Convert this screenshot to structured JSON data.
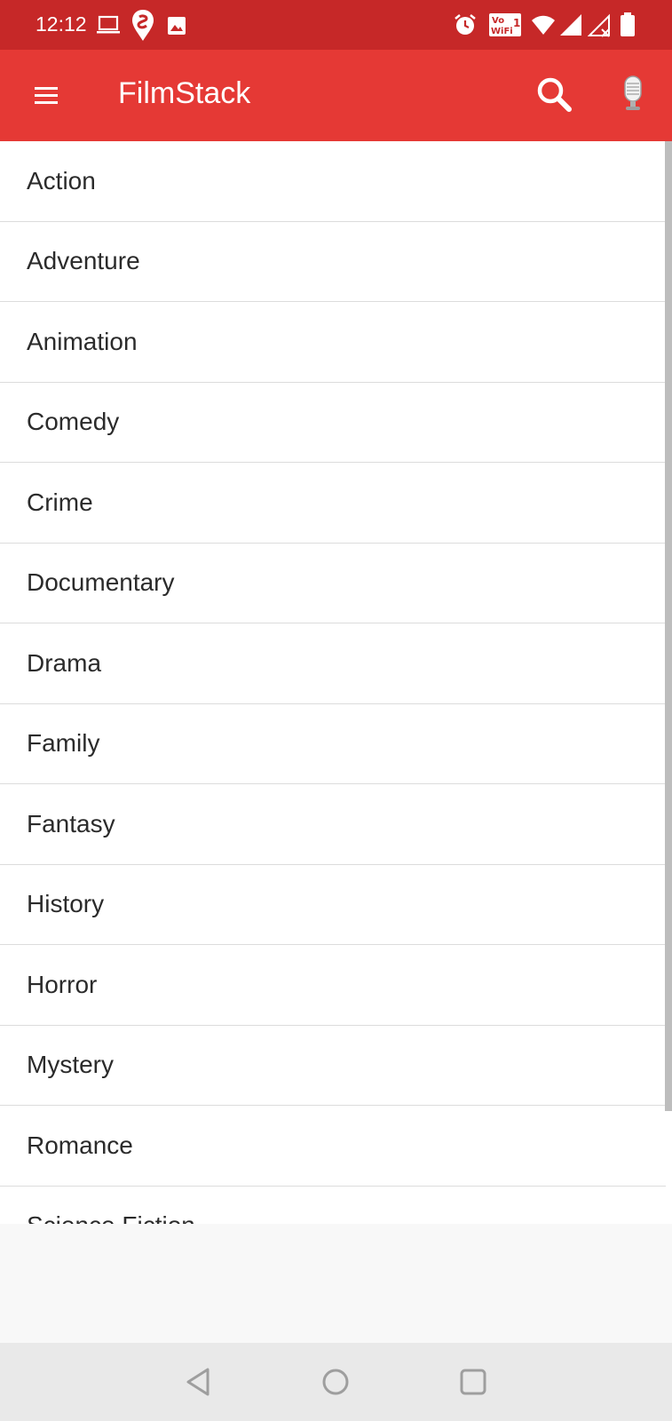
{
  "status_bar": {
    "time": "12:12",
    "left_icons": [
      "laptop-icon",
      "swiggy-icon",
      "image-icon"
    ],
    "right_icons": [
      "alarm-icon",
      "vowifi-icon",
      "wifi-icon",
      "signal-icon",
      "signal-no-data-icon",
      "battery-icon"
    ],
    "vowifi_text": "Vo WiFi",
    "bg_color": "#c62828"
  },
  "app_bar": {
    "title": "FilmStack",
    "menu_icon": "hamburger-menu-icon",
    "search_icon": "search-icon",
    "mic_icon": "microphone-icon",
    "bg_color": "#e53935"
  },
  "genres": [
    {
      "label": "Action"
    },
    {
      "label": "Adventure"
    },
    {
      "label": "Animation"
    },
    {
      "label": "Comedy"
    },
    {
      "label": "Crime"
    },
    {
      "label": "Documentary"
    },
    {
      "label": "Drama"
    },
    {
      "label": "Family"
    },
    {
      "label": "Fantasy"
    },
    {
      "label": "History"
    },
    {
      "label": "Horror"
    },
    {
      "label": "Mystery"
    },
    {
      "label": "Romance"
    },
    {
      "label": "Science Fiction"
    }
  ],
  "nav_bar": {
    "back_icon": "back-triangle-icon",
    "home_icon": "home-circle-icon",
    "recents_icon": "recents-square-icon"
  }
}
